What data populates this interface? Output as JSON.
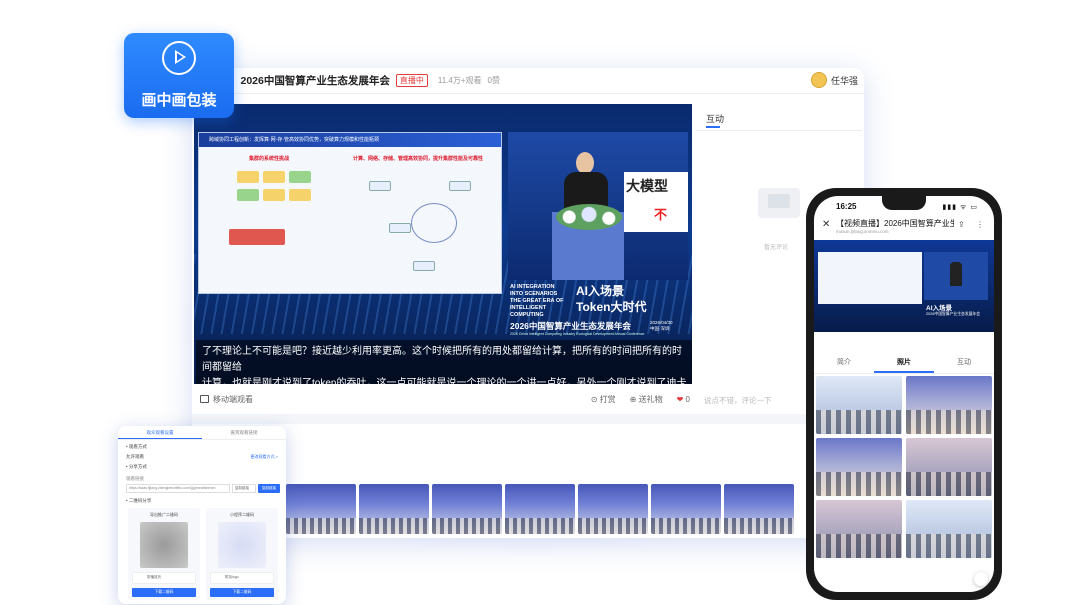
{
  "badge": {
    "label": "画中画包装",
    "icon": "play-circle-icon"
  },
  "window": {
    "title": "】2026中国智算产业生态发展年会",
    "live_tag": "直播中",
    "views": "11.4万+观看",
    "likes": "0赞",
    "user_name": "任华强"
  },
  "video": {
    "slide_header": "跨域协同工程创新：发挥算·网·存·管高效协同优势，突破算力规模和性能瓶颈",
    "slide_left_title": "集群的系统性挑战",
    "slide_right_title": "计算、网络、存储、管理高效协同，提升集群性能及可靠性",
    "stage_banner": "大模型",
    "stage_banner_red": "不",
    "brand_lines": [
      "AI INTEGRATION",
      "INTO SCENARIOS",
      "THE GREAT ERA OF",
      "INTELLIGENT COMPUTING"
    ],
    "brand_big_1": "AI入场景",
    "brand_big_2": "Token大时代",
    "brand_event": "2026中国智算产业生态发展年会",
    "brand_sub": "2026 China Intelligent Computing Industry Ecological Development Annual Conference",
    "brand_date_1": "2026/04/30",
    "brand_date_2": "中国·深圳",
    "caption_line1": "了不理论上不可能是吧？接近越少利用率更高。这个时候把所有的用处都留给计算，把所有的时间把所有的时间都留给",
    "caption_line2": "计算，也就是刚才说到了token的吞吐，这一点可能就是说一个理论的一个讲一点好，另外一个刚才说到了迪卡斯就"
  },
  "side_panel": {
    "title": "互动",
    "empty_text": "暂无评论",
    "comment_placeholder": "说点不错，评论一下"
  },
  "toolbar": {
    "mobile_label": "移动端观看",
    "tip_label": "打赏",
    "invite_label": "送礼物",
    "gift_count": "0"
  },
  "mini_window": {
    "tab_1": "观众观看设置",
    "tab_2": "嘉宾观看链接",
    "row_1": "• 观看方式",
    "row_2": "允许观看",
    "row_2_link": "更改观看方式 >",
    "row_3": "• 分享方式",
    "row_4": "观看链接",
    "link_value": "https://saas.fjjlang.zhengbeichifiho.com/{{gimedbshrhen",
    "copy_small": "复制链接",
    "copy_btn": "复制链接",
    "row_5": "• 二维码分享",
    "card_1_title": "导出推广二维码",
    "card_2_title": "小程序二维码",
    "card_1_opt": "带播放页",
    "card_2_opt": "附加logo",
    "download_1": "下载二维码",
    "download_2": "下载二维码"
  },
  "phone": {
    "time": "16:25",
    "status": "▮▮▮ ᯤ ▭",
    "page_title": "【视频直播】2026中国智算产业生",
    "url": "mosun.lyfang.xnmmu.com",
    "brand": "AI入场景",
    "brand_sub": "2026中国智算产业生态发展年会",
    "tabs": [
      "简介",
      "照片",
      "互动"
    ],
    "active_tab": "照片"
  },
  "colors": {
    "accent": "#2b6df6",
    "live_red": "#e23c3c",
    "video_bg": "#0d3b8e"
  }
}
